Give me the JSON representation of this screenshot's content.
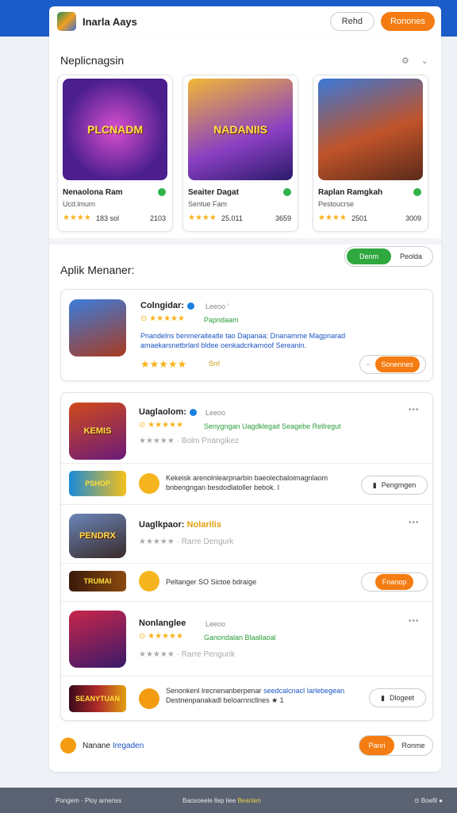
{
  "header": {
    "title": "Inarla Aays",
    "btn1": "Rehd",
    "btn2": "Ronones"
  },
  "section1": {
    "title": "Neplicnagsin",
    "icons": "⚙ ⌄",
    "cards": [
      {
        "art": "PLCNADM",
        "name": "Nenaolona Ram",
        "sub": "Ucd.lmurn",
        "stars": "★★★★",
        "size": "183 sol",
        "count": "2103"
      },
      {
        "art": "NADANIIS",
        "name": "Seaiter Dagat",
        "sub": "Sentue Fam",
        "stars": "★★★★",
        "size": "25.011",
        "count": "3659"
      },
      {
        "art": "",
        "name": "Raplan Ramgkah",
        "sub": "Pestoucrse",
        "stars": "★★★★",
        "size": "2501",
        "count": "3009"
      }
    ]
  },
  "section2": {
    "title": "Aplik Menaner:",
    "toggle_on": "Denm",
    "toggle_off": "Peolda"
  },
  "apps": {
    "a1": {
      "name": "Colngidar:",
      "meta": "Leeoo '",
      "rating_line": "⊙ ★★★★★",
      "green": "Papndaam",
      "desc": "Pnandelns benmeraiteatle tao Dapanaa: Dnanamme Magpnarad amaekarsnetbrlanl bldee oenkadcrkarnoof Sereanin.",
      "stars": "★★★★★",
      "stars_label": "Srrl",
      "button": "Sonennes"
    },
    "a2": {
      "name": "Uaglaolom:",
      "meta": "Leeoo",
      "rating_line": "⊙ ★★★★★",
      "green": "Senygngan Uagdklegait Seagebe Rellregut",
      "grey_line": "★★★★★ · Bolm Pnangikez",
      "art": "KEMIS"
    },
    "b1": {
      "art": "PSHOP",
      "text": "Kekeisk arenolnlearpnarbin baeolecbaloimagnlaom bnbengngan besdodlatoller bebok. I",
      "button": "Pengmgen"
    },
    "a3": {
      "name": "Uaglkpaor:",
      "tag": "Nolarilis",
      "grey_line": "★★★★★ · Rarre Dengurk",
      "art": "PENDRX"
    },
    "b2": {
      "art": "TRUMAI",
      "text": "Peltanger SO Sictoe bdraige",
      "button": "Fnanop"
    },
    "a4": {
      "name": "Nonlanglee",
      "meta": "Leeoo",
      "rating_line": "⊙ ★★★★★",
      "green": "Ganondalan Blaallaoal",
      "grey_line": "★★★★★ · Rarre Pengurik"
    },
    "b3": {
      "art": "SEANYTUAN",
      "text1": "Senonkenl lrecnenanberpenar",
      "text1b": "seedcalcnacl Iarlebegean",
      "text2": "Destnenpanakadl beloarnncllnes ★ 1",
      "button": "Dlogeet"
    }
  },
  "bottom": {
    "label1": "Nanane",
    "label2": "Iregaden",
    "seg_on": "Panri",
    "seg_off": "Ronme"
  },
  "footer": {
    "left": "Pongem · Ploy arnenss",
    "mid": "Baosoeele llep liee",
    "mid_link": "Beanlen",
    "right": "Boefil"
  },
  "colors": {
    "brand_blue": "#1a5cc8",
    "accent_orange": "#f57c12",
    "green": "#2fa83f",
    "star": "#f7b21a"
  }
}
